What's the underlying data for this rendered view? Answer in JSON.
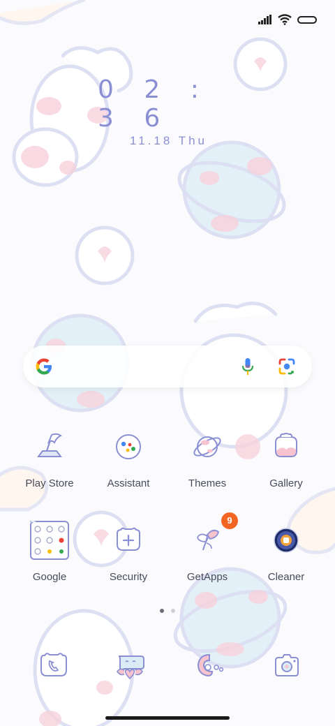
{
  "clock": {
    "time": "0 2 : 3 6",
    "date": "11.18 Thu"
  },
  "search": {
    "provider_icon": "google-g-icon",
    "voice_icon": "mic-icon",
    "lens_icon": "lens-icon"
  },
  "apps": [
    {
      "label": "Play Store",
      "icon": "flag-icon"
    },
    {
      "label": "Assistant",
      "icon": "assistant-icon"
    },
    {
      "label": "Themes",
      "icon": "planet-icon"
    },
    {
      "label": "Gallery",
      "icon": "gallery-icon"
    },
    {
      "label": "Google",
      "icon": "folder-icon"
    },
    {
      "label": "Security",
      "icon": "shield-plus-icon"
    },
    {
      "label": "GetApps",
      "icon": "butterfly-icon",
      "badge": "9"
    },
    {
      "label": "Cleaner",
      "icon": "cleaner-icon"
    }
  ],
  "page_indicator": {
    "pages": 2,
    "current": 1
  },
  "dock": [
    {
      "name": "phone",
      "icon": "phone-icon"
    },
    {
      "name": "messages",
      "icon": "message-icon"
    },
    {
      "name": "browser",
      "icon": "browser-icon"
    },
    {
      "name": "camera",
      "icon": "camera-icon"
    }
  ],
  "colors": {
    "accent": "#8a8fd3",
    "pink": "#f6c3cf",
    "sky": "#dcecf6",
    "badge": "#f26522"
  }
}
